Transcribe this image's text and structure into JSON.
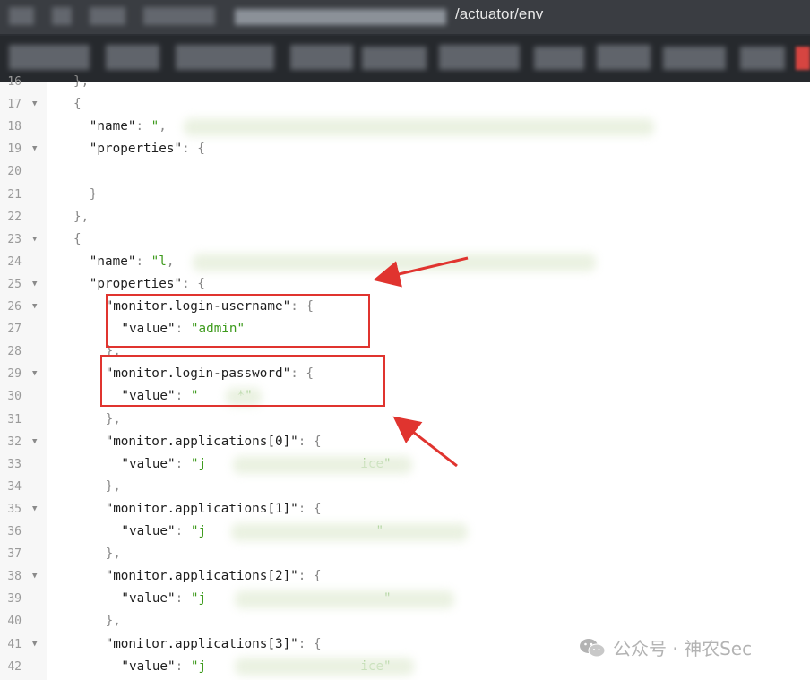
{
  "browser": {
    "url_visible": "/actuator/env"
  },
  "editor": {
    "lines": [
      {
        "n": "16",
        "fold": false,
        "indent": 1,
        "parts": [
          [
            "p",
            "},"
          ]
        ]
      },
      {
        "n": "17",
        "fold": true,
        "indent": 1,
        "parts": [
          [
            "p",
            "{"
          ]
        ]
      },
      {
        "n": "18",
        "fold": false,
        "indent": 2,
        "parts": [
          [
            "k",
            "\"name\""
          ],
          [
            "p",
            ": "
          ],
          [
            "s",
            "\""
          ],
          [
            "p",
            ","
          ]
        ]
      },
      {
        "n": "19",
        "fold": true,
        "indent": 2,
        "parts": [
          [
            "k",
            "\"properties\""
          ],
          [
            "p",
            ": {"
          ]
        ]
      },
      {
        "n": "20",
        "fold": false,
        "indent": 2,
        "parts": []
      },
      {
        "n": "21",
        "fold": false,
        "indent": 2,
        "parts": [
          [
            "p",
            "}"
          ]
        ]
      },
      {
        "n": "22",
        "fold": false,
        "indent": 1,
        "parts": [
          [
            "p",
            "},"
          ]
        ]
      },
      {
        "n": "23",
        "fold": true,
        "indent": 1,
        "parts": [
          [
            "p",
            "{"
          ]
        ]
      },
      {
        "n": "24",
        "fold": false,
        "indent": 2,
        "parts": [
          [
            "k",
            "\"name\""
          ],
          [
            "p",
            ": "
          ],
          [
            "s",
            "\"l"
          ],
          [
            "p",
            ","
          ]
        ]
      },
      {
        "n": "25",
        "fold": true,
        "indent": 2,
        "parts": [
          [
            "k",
            "\"properties\""
          ],
          [
            "p",
            ": {"
          ]
        ]
      },
      {
        "n": "26",
        "fold": true,
        "indent": 3,
        "parts": [
          [
            "k",
            "\"monitor.login-username\""
          ],
          [
            "p",
            ": {"
          ]
        ]
      },
      {
        "n": "27",
        "fold": false,
        "indent": 4,
        "parts": [
          [
            "k",
            "\"value\""
          ],
          [
            "p",
            ": "
          ],
          [
            "s",
            "\"admin\""
          ]
        ]
      },
      {
        "n": "28",
        "fold": false,
        "indent": 3,
        "parts": [
          [
            "p",
            "},"
          ]
        ]
      },
      {
        "n": "29",
        "fold": true,
        "indent": 3,
        "parts": [
          [
            "k",
            "\"monitor.login-password\""
          ],
          [
            "p",
            ": {"
          ]
        ]
      },
      {
        "n": "30",
        "fold": false,
        "indent": 4,
        "parts": [
          [
            "k",
            "\"value\""
          ],
          [
            "p",
            ": "
          ],
          [
            "s",
            "\"     *\""
          ]
        ]
      },
      {
        "n": "31",
        "fold": false,
        "indent": 3,
        "parts": [
          [
            "p",
            "},"
          ]
        ]
      },
      {
        "n": "32",
        "fold": true,
        "indent": 3,
        "parts": [
          [
            "k",
            "\"monitor.applications[0]\""
          ],
          [
            "p",
            ": {"
          ]
        ]
      },
      {
        "n": "33",
        "fold": false,
        "indent": 4,
        "parts": [
          [
            "k",
            "\"value\""
          ],
          [
            "p",
            ": "
          ],
          [
            "s",
            "\"j                    ice\""
          ]
        ]
      },
      {
        "n": "34",
        "fold": false,
        "indent": 3,
        "parts": [
          [
            "p",
            "},"
          ]
        ]
      },
      {
        "n": "35",
        "fold": true,
        "indent": 3,
        "parts": [
          [
            "k",
            "\"monitor.applications[1]\""
          ],
          [
            "p",
            ": {"
          ]
        ]
      },
      {
        "n": "36",
        "fold": false,
        "indent": 4,
        "parts": [
          [
            "k",
            "\"value\""
          ],
          [
            "p",
            ": "
          ],
          [
            "s",
            "\"j                      \""
          ]
        ]
      },
      {
        "n": "37",
        "fold": false,
        "indent": 3,
        "parts": [
          [
            "p",
            "},"
          ]
        ]
      },
      {
        "n": "38",
        "fold": true,
        "indent": 3,
        "parts": [
          [
            "k",
            "\"monitor.applications[2]\""
          ],
          [
            "p",
            ": {"
          ]
        ]
      },
      {
        "n": "39",
        "fold": false,
        "indent": 4,
        "parts": [
          [
            "k",
            "\"value\""
          ],
          [
            "p",
            ": "
          ],
          [
            "s",
            "\"j                       \""
          ]
        ]
      },
      {
        "n": "40",
        "fold": false,
        "indent": 3,
        "parts": [
          [
            "p",
            "},"
          ]
        ]
      },
      {
        "n": "41",
        "fold": true,
        "indent": 3,
        "parts": [
          [
            "k",
            "\"monitor.applications[3]\""
          ],
          [
            "p",
            ": {"
          ]
        ]
      },
      {
        "n": "42",
        "fold": false,
        "indent": 4,
        "parts": [
          [
            "k",
            "\"value\""
          ],
          [
            "p",
            ": "
          ],
          [
            "s",
            "\"j                    ice\""
          ]
        ]
      }
    ]
  },
  "watermark": {
    "text": "公众号 · 神农Sec"
  },
  "colors": {
    "annotation_red": "#e0342f",
    "string_green": "#3d9a1c"
  }
}
